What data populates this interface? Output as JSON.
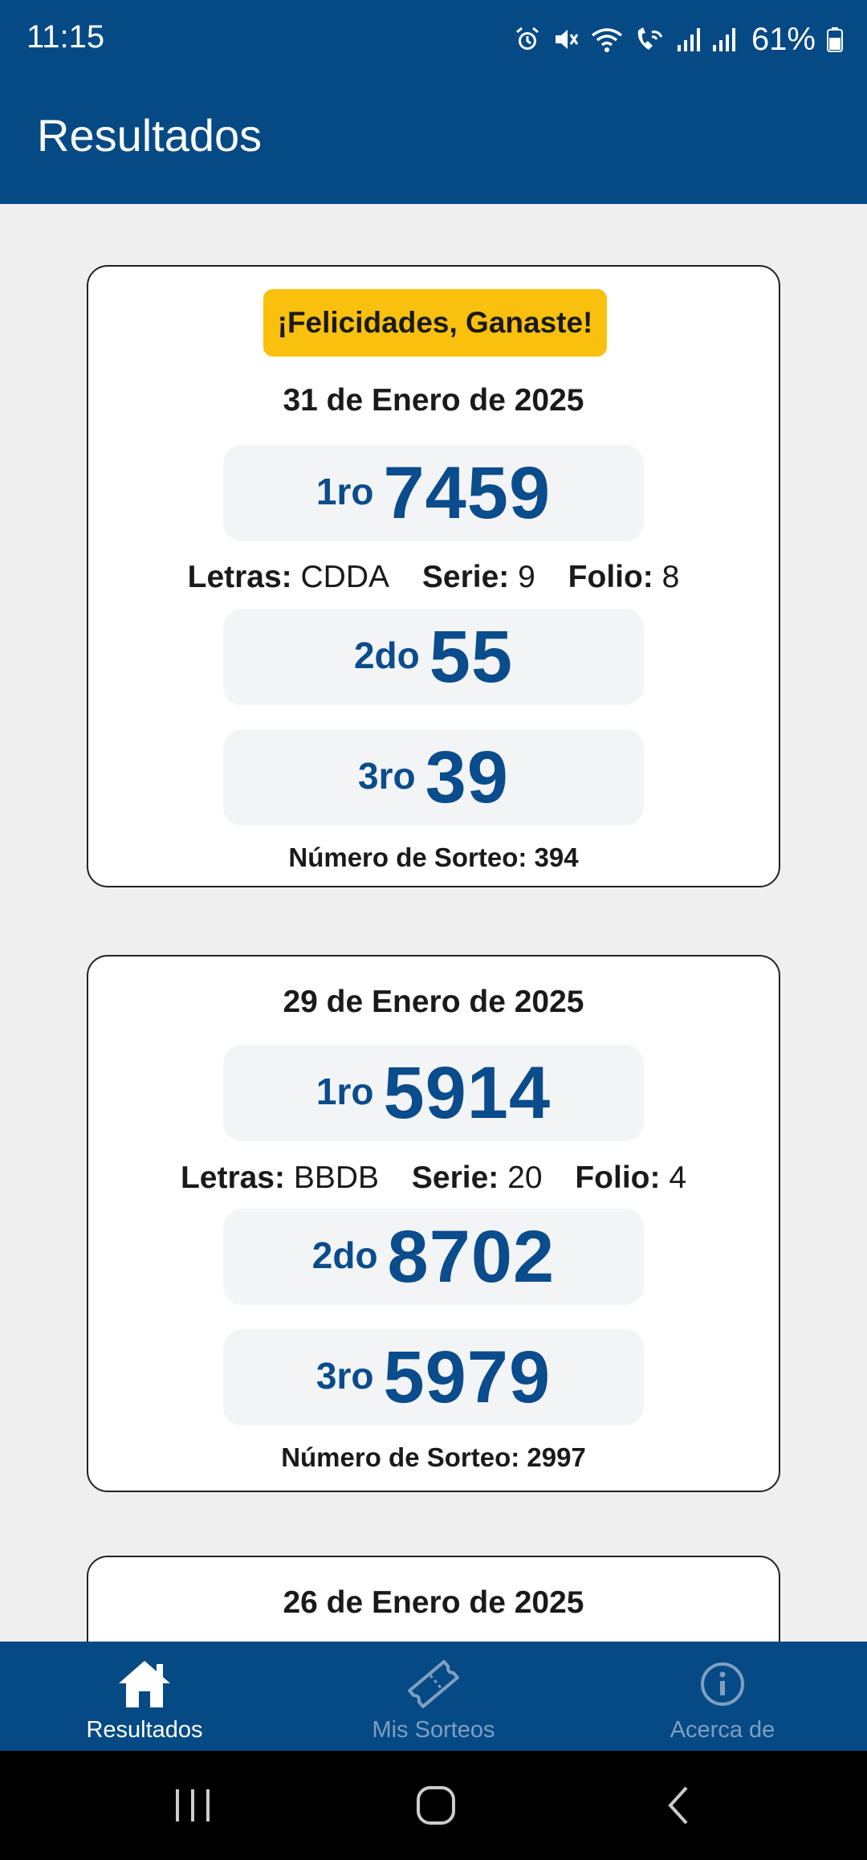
{
  "status_bar": {
    "time": "11:15",
    "battery": "61%",
    "icons": [
      "alarm-icon",
      "mute-icon",
      "wifi-icon",
      "wifi-calling-icon",
      "signal-icon",
      "signal-icon",
      "battery-icon"
    ]
  },
  "app_bar": {
    "title": "Resultados"
  },
  "colors": {
    "primary": "#054a85",
    "accent": "#f9c00d",
    "number": "#0a4c8c"
  },
  "results": [
    {
      "winner_badge": "¡Felicidades, Ganaste!",
      "date": "31 de Enero de 2025",
      "prizes": [
        {
          "rank": "1ro",
          "number": "7459"
        },
        {
          "rank": "2do",
          "number": "55"
        },
        {
          "rank": "3ro",
          "number": "39"
        }
      ],
      "details": {
        "letras_label": "Letras:",
        "letras": "CDDA",
        "serie_label": "Serie:",
        "serie": "9",
        "folio_label": "Folio:",
        "folio": "8"
      },
      "draw_number": "Número de Sorteo: 394"
    },
    {
      "date": "29 de Enero de 2025",
      "prizes": [
        {
          "rank": "1ro",
          "number": "5914"
        },
        {
          "rank": "2do",
          "number": "8702"
        },
        {
          "rank": "3ro",
          "number": "5979"
        }
      ],
      "details": {
        "letras_label": "Letras:",
        "letras": "BBDB",
        "serie_label": "Serie:",
        "serie": "20",
        "folio_label": "Folio:",
        "folio": "4"
      },
      "draw_number": "Número de Sorteo: 2997"
    },
    {
      "date": "26 de Enero de 2025"
    }
  ],
  "bottom_nav": [
    {
      "label": "Resultados",
      "icon": "home-icon",
      "active": true
    },
    {
      "label": "Mis Sorteos",
      "icon": "ticket-icon",
      "active": false
    },
    {
      "label": "Acerca de",
      "icon": "info-icon",
      "active": false
    }
  ],
  "system_nav": [
    "recents-icon",
    "home-circle-icon",
    "back-icon"
  ]
}
